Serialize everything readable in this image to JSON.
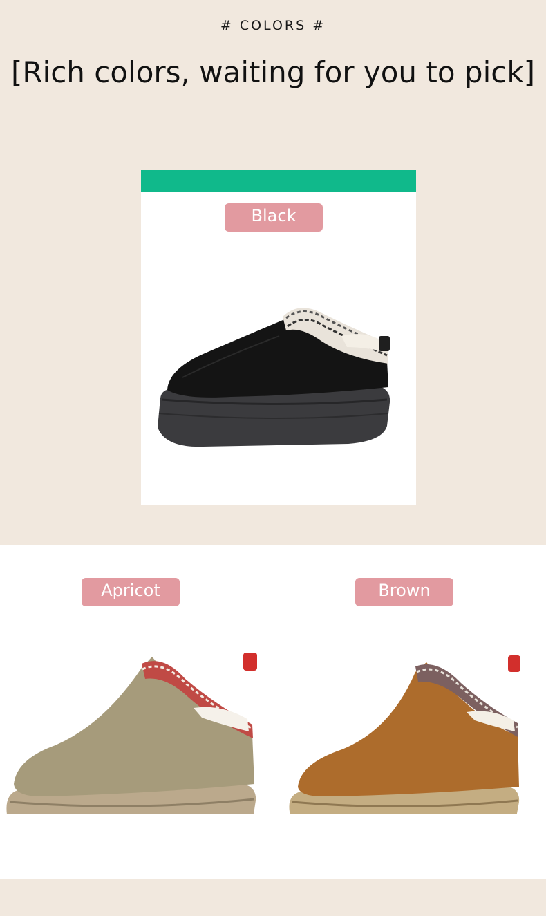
{
  "header": {
    "eyebrow": "# COLORS #",
    "headline": "[Rich colors, waiting for you to pick]"
  },
  "colors": {
    "page_background": "#f1e8de",
    "accent_bar": "#10b98b",
    "label_pill": "#e29aa0"
  },
  "products": [
    {
      "label": "Black",
      "image": "black-slipper-image"
    },
    {
      "label": "Apricot",
      "image": "apricot-slipper-image"
    },
    {
      "label": "Brown",
      "image": "brown-slipper-image"
    }
  ]
}
